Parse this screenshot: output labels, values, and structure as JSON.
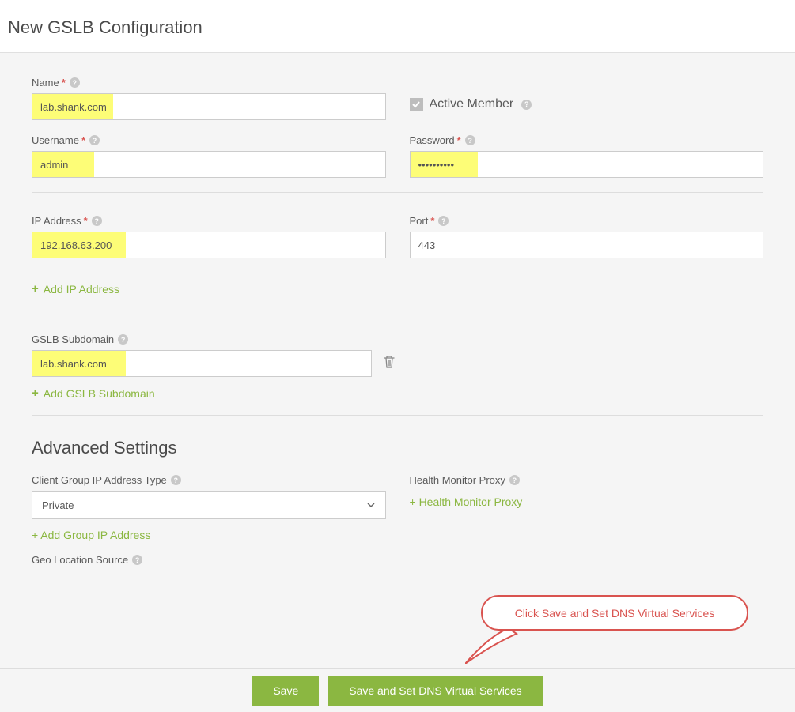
{
  "page_title": "New GSLB Configuration",
  "fields": {
    "name": {
      "label": "Name",
      "value": "lab.shank.com"
    },
    "active_member": {
      "label": "Active Member",
      "checked": true
    },
    "username": {
      "label": "Username",
      "value": "admin"
    },
    "password": {
      "label": "Password",
      "value": "••••••••••"
    },
    "ip_address": {
      "label": "IP Address",
      "value": "192.168.63.200"
    },
    "port": {
      "label": "Port",
      "value": "443"
    },
    "add_ip": "Add IP Address",
    "gslb_subdomain": {
      "label": "GSLB Subdomain",
      "value": "lab.shank.com"
    },
    "add_subdomain": "Add GSLB Subdomain"
  },
  "advanced": {
    "title": "Advanced Settings",
    "client_group": {
      "label": "Client Group IP Address Type",
      "value": "Private"
    },
    "add_group": "+ Add Group IP Address",
    "health_monitor": {
      "label": "Health Monitor Proxy",
      "link": "+ Health Monitor Proxy"
    },
    "geo": {
      "label": "Geo Location Source"
    }
  },
  "callout": "Click Save and Set DNS Virtual Services",
  "buttons": {
    "save": "Save",
    "save_dns": "Save and Set DNS Virtual Services"
  }
}
